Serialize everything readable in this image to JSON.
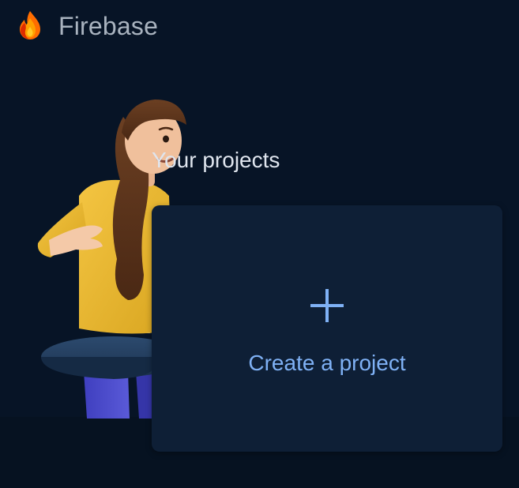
{
  "brand": {
    "name": "Firebase",
    "logo_icon": "firebase-flame-icon"
  },
  "main": {
    "title": "Your projects",
    "create_card": {
      "icon": "plus-icon",
      "label": "Create a project"
    }
  },
  "colors": {
    "background": "#071426",
    "card": "#0e1f36",
    "accent": "#7fb1f5",
    "title_text": "#dfe5ee",
    "brand_text": "#a9b3bf"
  }
}
